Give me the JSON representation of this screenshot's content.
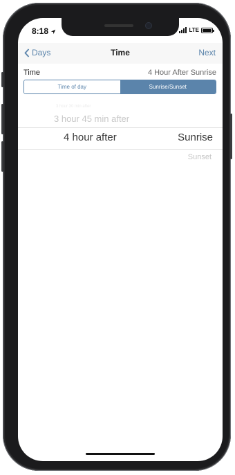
{
  "status_bar": {
    "time": "8:18",
    "network": "LTE"
  },
  "nav": {
    "back_label": "Days",
    "title": "Time",
    "next_label": "Next"
  },
  "time_setting": {
    "label": "Time",
    "value": "4 Hour After Sunrise"
  },
  "segments": [
    {
      "label": "Time of day",
      "selected": false
    },
    {
      "label": "Sunrise/Sunset",
      "selected": true
    }
  ],
  "picker": {
    "offset_column": {
      "faint_above": "3 hour 30 min after",
      "above": "3 hour 45 min after",
      "selected": "4 hour after"
    },
    "event_column": {
      "selected": "Sunrise",
      "below": "Sunset"
    }
  },
  "colors": {
    "accent": "#5b84ab",
    "frame": "#1b1b1d"
  }
}
